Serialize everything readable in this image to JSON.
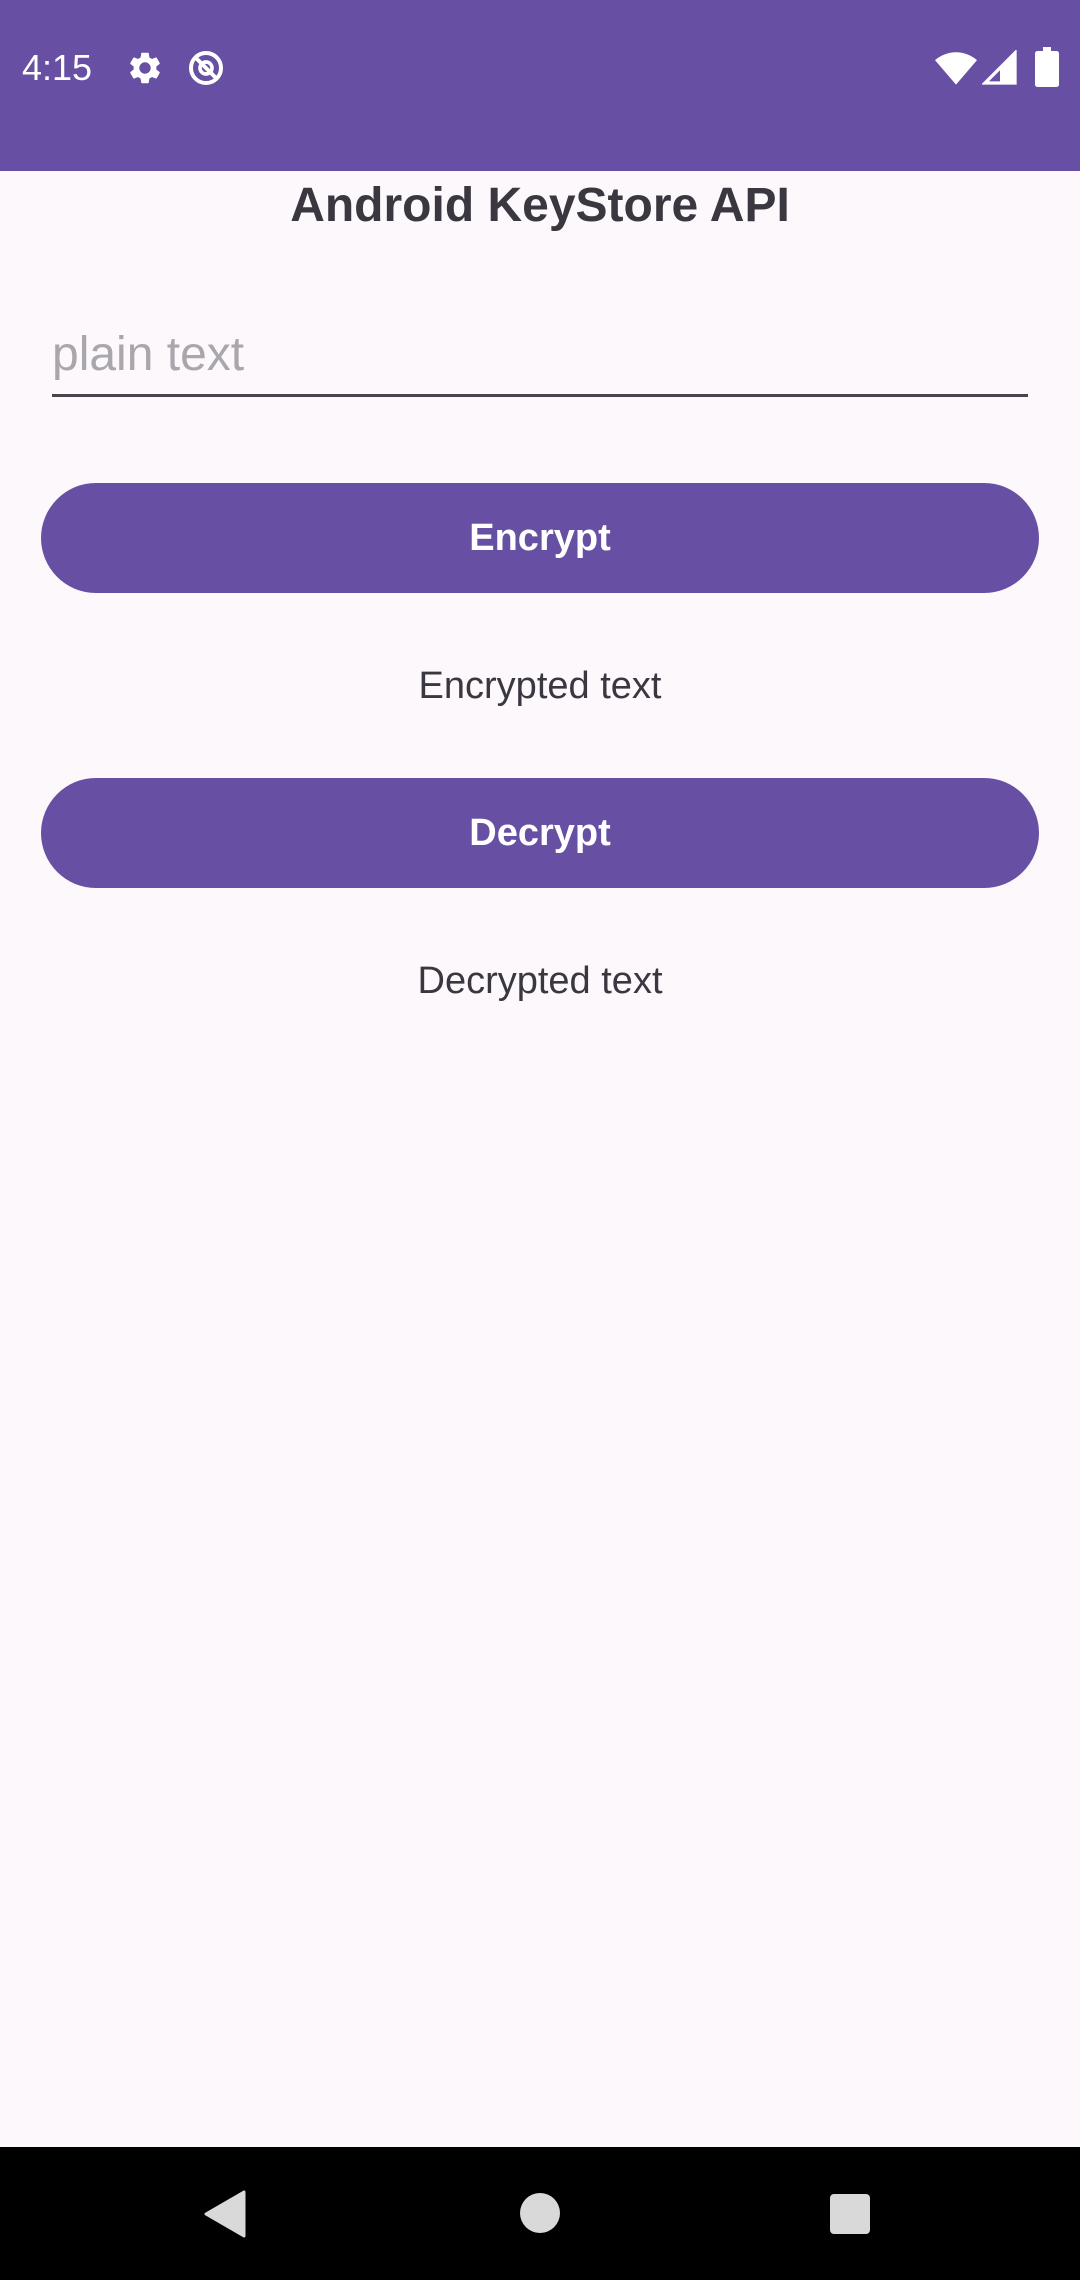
{
  "status_bar": {
    "time": "4:15",
    "icons": [
      "gear-icon",
      "no-disturb-icon",
      "wifi-icon",
      "cell-signal-icon",
      "battery-icon"
    ],
    "background": "#6750A4"
  },
  "app": {
    "title": "Android KeyStore API",
    "plain_input": {
      "value": "",
      "placeholder": "plain text"
    },
    "encrypt_button": "Encrypt",
    "encrypted_text": "Encrypted text",
    "decrypt_button": "Decrypt",
    "decrypted_text": "Decrypted text",
    "accent": "#6750A4",
    "background": "#FDF8FC"
  },
  "nav_bar": {
    "buttons": [
      "back-icon",
      "home-icon",
      "recents-icon"
    ]
  }
}
